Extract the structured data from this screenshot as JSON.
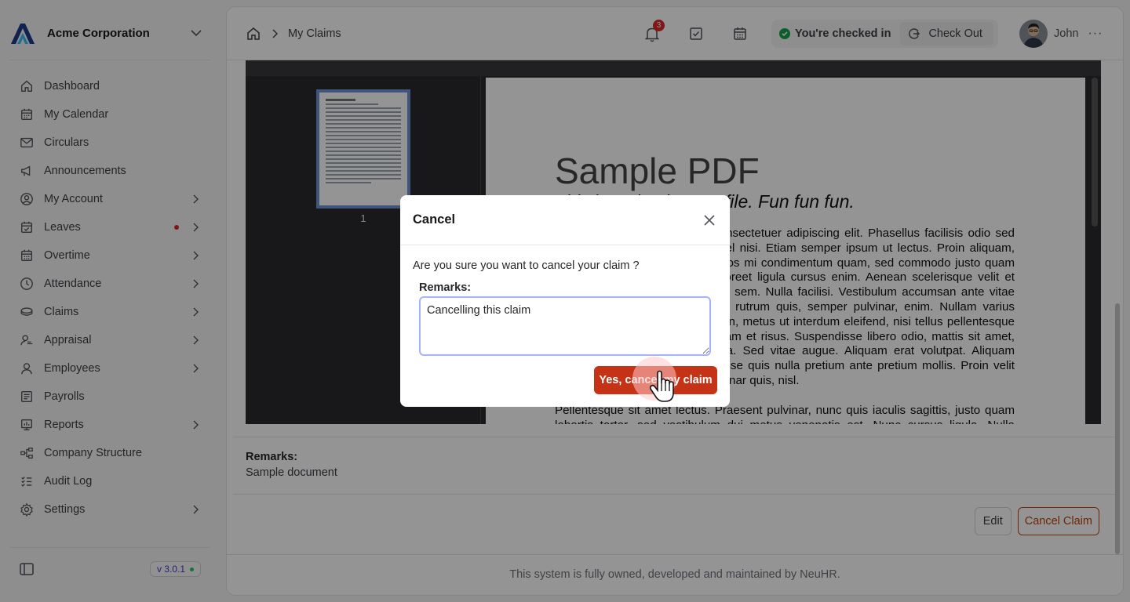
{
  "org": {
    "name": "Acme Corporation"
  },
  "nav": {
    "items": [
      {
        "label": "Dashboard",
        "icon": "home-icon"
      },
      {
        "label": "My Calendar",
        "icon": "calendar-icon"
      },
      {
        "label": "Circulars",
        "icon": "mail-icon"
      },
      {
        "label": "Announcements",
        "icon": "megaphone-icon"
      },
      {
        "label": "My Account",
        "icon": "user-circle-icon"
      },
      {
        "label": "Leaves",
        "icon": "calendar-check-icon"
      },
      {
        "label": "Overtime",
        "icon": "calendar-clock-icon"
      },
      {
        "label": "Attendance",
        "icon": "clock-icon"
      },
      {
        "label": "Claims",
        "icon": "coins-icon"
      },
      {
        "label": "Appraisal",
        "icon": "user-star-icon"
      },
      {
        "label": "Employees",
        "icon": "user-icon"
      },
      {
        "label": "Payrolls",
        "icon": "list-icon"
      },
      {
        "label": "Reports",
        "icon": "chart-icon"
      },
      {
        "label": "Company Structure",
        "icon": "org-chart-icon"
      },
      {
        "label": "Audit Log",
        "icon": "checklist-icon"
      },
      {
        "label": "Settings",
        "icon": "gear-icon"
      }
    ]
  },
  "version": "v 3.0.1",
  "breadcrumb": {
    "current": "My Claims"
  },
  "notifications": {
    "count": "3"
  },
  "checkin": {
    "status": "You're checked in",
    "checkout_label": "Check Out"
  },
  "user": {
    "name": "John",
    "more": "···"
  },
  "pdf": {
    "thumb_page": "1",
    "title": "Sample PDF",
    "subtitle": "This is a simple PDF file. Fun fun fun.",
    "para1": "Lorem ipsum dolor sit amet, consectetuer adipiscing elit. Phasellus facilisis odio sed mi. Curabitur suscipit. Nullam vel nisi. Etiam semper ipsum ut lectus. Proin aliquam, erat eget pharetra commodo, eros mi condimentum quam, sed commodo justo quam ut velit. Integer a erat. Cras laoreet ligula cursus enim. Aenean scelerisque velit et tellus. Vestibulum dictum aliquet sem. Nulla facilisi. Vestibulum accumsan ante vitae elit. Nulla erat dolor, blandit in, rutrum quis, semper pulvinar, enim. Nullam varius congue risus. Vivamus sollicitudin, metus ut interdum eleifend, nisi tellus pellentesque elit, tristique accumsan eros quam et risus. Suspendisse libero odio, mattis sit amet, aliquet eget, hendrerit vel, nulla. Sed vitae augue. Aliquam erat volutpat. Aliquam feugiat vulputate nisl. Suspendisse quis nulla pretium ante pretium mollis. Proin velit ligula, sagittis at, egestas a, pulvinar quis, nisl.",
    "para2": "Pellentesque sit amet lectus. Praesent pulvinar, nunc quis iaculis sagittis, justo quam lobortis tortor, sed vestibulum dui metus venenatis est. Nunc cursus ligula. Nulla facilisi."
  },
  "claim": {
    "remarks_label": "Remarks:",
    "remarks_value": "Sample document"
  },
  "actions": {
    "edit_label": "Edit",
    "cancel_label": "Cancel Claim"
  },
  "footer": {
    "text": "This system is fully owned, developed and maintained by NeuHR."
  },
  "modal": {
    "title": "Cancel",
    "message": "Are you sure you want to cancel your claim ?",
    "remarks_label": "Remarks:",
    "remarks_value": "Cancelling this claim",
    "confirm_label": "Yes, cancel my claim"
  },
  "colors": {
    "accent": "#c63216",
    "brand": "#1e3a8a",
    "success": "#16a34a",
    "badge": "#dc2626"
  }
}
